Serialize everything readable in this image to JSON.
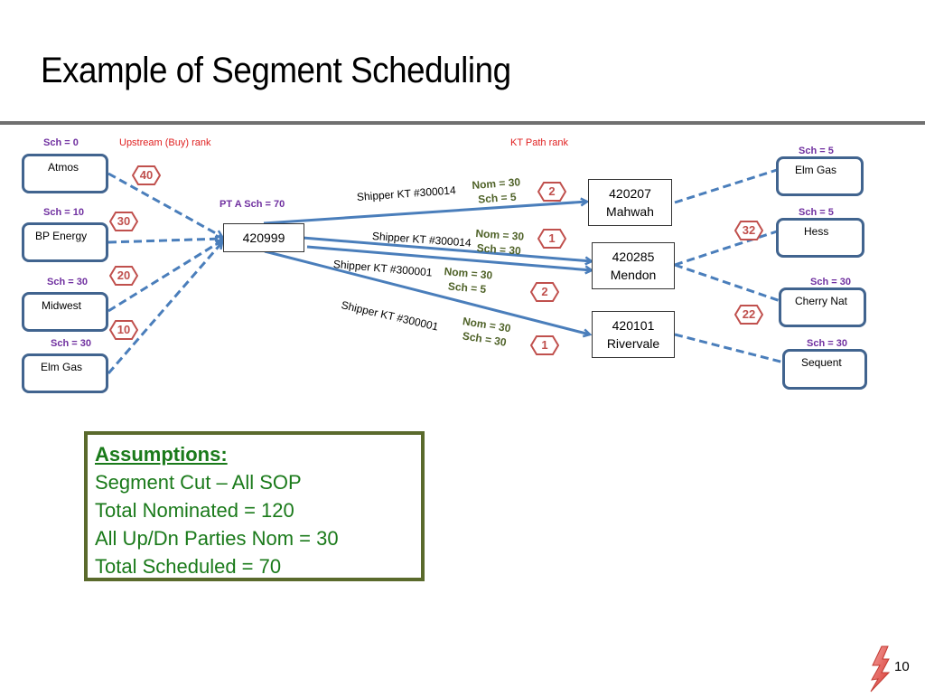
{
  "slide": {
    "title": "Example of Segment Scheduling",
    "page_number": "10",
    "logo_icon": "lightning-bolt-icon"
  },
  "headers": {
    "upstream_rank": "Upstream (Buy) rank",
    "kt_path_rank": "KT Path rank"
  },
  "upstream": [
    {
      "name": "Atmos",
      "sch": "Sch = 0",
      "rank": "40"
    },
    {
      "name": "BP Energy",
      "sch": "Sch = 10",
      "rank": "30"
    },
    {
      "name": "Midwest",
      "sch": "Sch = 30",
      "rank": "20"
    },
    {
      "name": "Elm Gas",
      "sch": "Sch = 30",
      "rank": "10"
    }
  ],
  "pool_point": {
    "id": "420999",
    "sch": "PT A Sch = 70"
  },
  "delivery_points": [
    {
      "id": "420207",
      "name": "Mahwah"
    },
    {
      "id": "420285",
      "name": "Mendon"
    },
    {
      "id": "420101",
      "name": "Rivervale"
    }
  ],
  "paths": [
    {
      "contract": "Shipper KT #300014",
      "nom": "Nom = 30",
      "sch": "Sch = 5",
      "rank": "2",
      "to": "420207"
    },
    {
      "contract": "Shipper KT #300014",
      "nom": "Nom = 30",
      "sch": "Sch = 30",
      "rank": "1",
      "to": "420285"
    },
    {
      "contract": "Shipper KT #300001",
      "nom": "Nom = 30",
      "sch": "Sch = 5",
      "rank": "2",
      "to": "420285"
    },
    {
      "contract": "Shipper KT #300001",
      "nom": "Nom = 30",
      "sch": "Sch = 30",
      "rank": "1",
      "to": "420101"
    }
  ],
  "downstream": [
    {
      "name": "Elm Gas",
      "sch": "Sch = 5",
      "rank": ""
    },
    {
      "name": "Hess",
      "sch": "Sch = 5",
      "rank": "32"
    },
    {
      "name": "Cherry Nat",
      "sch": "Sch = 30",
      "rank": "22"
    },
    {
      "name": "Sequent",
      "sch": "Sch = 30",
      "rank": ""
    }
  ],
  "assumptions": {
    "heading": "Assumptions:",
    "lines": [
      "Segment Cut – All SOP",
      "Total Nominated = 120",
      "All Up/Dn Parties Nom = 30",
      "Total Scheduled = 70"
    ]
  },
  "colors": {
    "line_blue": "#4a7ebb",
    "party_border": "#41648f",
    "rank_red": "#c0504d",
    "sch_purple": "#7030a0",
    "nom_green": "#4f6228",
    "assumption_green": "#1a7a1a",
    "assumption_border": "#5a6a2c"
  }
}
